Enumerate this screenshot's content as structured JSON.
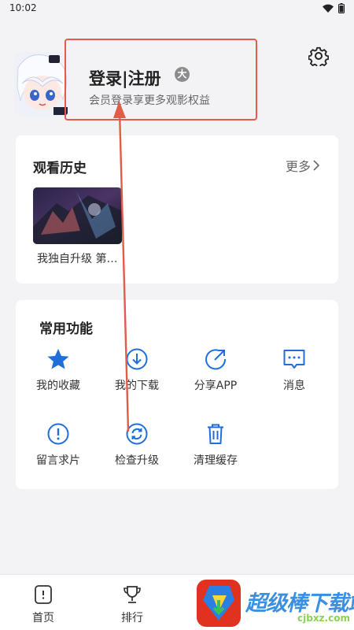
{
  "status_bar": {
    "time": "10:02"
  },
  "profile": {
    "login_label": "登录|注册",
    "badge_glyph": "大",
    "subtitle": "会员登录享更多观影权益",
    "settings_icon": "gear-icon"
  },
  "history": {
    "title": "观看历史",
    "more_label": "更多",
    "items": [
      {
        "caption": "我独自升级 第…"
      }
    ]
  },
  "functions": {
    "title": "常用功能",
    "items": [
      {
        "label": "我的收藏",
        "icon": "star-icon"
      },
      {
        "label": "我的下载",
        "icon": "download-icon"
      },
      {
        "label": "分享APP",
        "icon": "share-icon"
      },
      {
        "label": "消息",
        "icon": "message-icon"
      },
      {
        "label": "留言求片",
        "icon": "exclamation-icon"
      },
      {
        "label": "检查升级",
        "icon": "refresh-icon"
      },
      {
        "label": "清理缓存",
        "icon": "trash-icon"
      }
    ]
  },
  "bottom_nav": {
    "items": [
      {
        "label": "首页",
        "icon": "home-icon"
      },
      {
        "label": "排行",
        "icon": "trophy-icon"
      }
    ]
  },
  "watermark": {
    "text": "超级棒下载站",
    "url": "cjbxz.com"
  },
  "colors": {
    "accent_blue": "#1e6fd9",
    "annotation_red": "#e25b4b",
    "background": "#f3f3f5"
  }
}
